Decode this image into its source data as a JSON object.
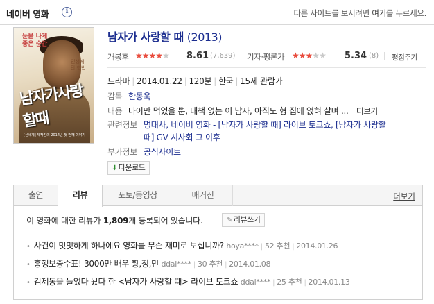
{
  "header": {
    "brand": "네이버 영화",
    "notice_prefix": "다른 사이트를 보시려면 ",
    "notice_link": "여기",
    "notice_suffix": "를 누르세요."
  },
  "poster": {
    "copy1": "눈물 나게\n좋은 순간",
    "copy2": "인생에\n단 한번",
    "title_art": "남자가사랑할때",
    "credit": "[신세계] 제작진의 2014년 첫 번째 이야기"
  },
  "movie": {
    "title": "남자가 사랑할 때",
    "year": "(2013)"
  },
  "ratings": {
    "audience_label": "개봉후",
    "audience_stars": 4.3,
    "audience_score": "8.61",
    "audience_count": "(7,639)",
    "critic_label": "기자·평론가",
    "critic_stars": 2.7,
    "critic_score": "5.34",
    "critic_count": "(8)",
    "rate_link": "평점주기"
  },
  "details": {
    "genre": "드라마",
    "release": "2014.01.22",
    "runtime": "120분",
    "country": "한국",
    "grade": "15세 관람가",
    "director_label": "감독",
    "director": "한동욱",
    "plot_label": "내용",
    "plot": "나이만 먹었을 뿐, 대책 없는 이 남자, 아직도 형 집에 얹혀 살며 ...",
    "plot_more": "더보기",
    "related_label": "관련정보",
    "related_line1": "명대사, 네이버 영화 - [남자가 사랑할 때] 라이브 토크쇼, [남자가 사랑할",
    "related_line2": "때] GV 시사회 그 이후",
    "extra_label": "부가정보",
    "extra": "공식사이트"
  },
  "download": {
    "label": "다운로드"
  },
  "tabs": [
    {
      "label": "출연"
    },
    {
      "label": "리뷰"
    },
    {
      "label": "포토/동영상"
    },
    {
      "label": "매거진"
    }
  ],
  "tab_more": "더보기",
  "review": {
    "summary_prefix": "이 영화에 대한 리뷰가 ",
    "summary_count": "1,809",
    "summary_suffix": "개 등록되어 있습니다.",
    "write_label": "리뷰쓰기",
    "items": [
      {
        "title": "사건이 밋밋하게 하나에요 영화를 무슨 재미로 보십니까?",
        "author": "hoya****",
        "recommend": "52 추천",
        "date": "2014.01.26"
      },
      {
        "title": "흥행보증수표! 3000만 배우 황,정,민",
        "author": "ddai****",
        "recommend": "30 추천",
        "date": "2014.01.08"
      },
      {
        "title": "김제동을 들었다 놨다 한 <남자가 사랑할 때> 라이브 토크쇼",
        "author": "ddai****",
        "recommend": "25 추천",
        "date": "2014.01.13"
      }
    ]
  },
  "colors": {
    "title_blue": "#1b2d8f",
    "star_red": "#e94b3c",
    "star_gray": "#c9c9c9"
  }
}
